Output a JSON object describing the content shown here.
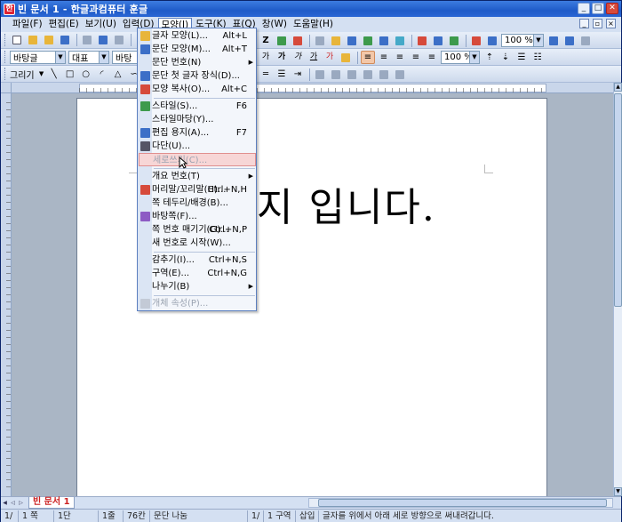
{
  "window": {
    "title": "빈 문서 1 - 한글과컴퓨터 훈글",
    "app_icon": "hwp-app-icon",
    "controls": [
      "minimize",
      "maximize",
      "close"
    ]
  },
  "menubar": {
    "items": [
      {
        "label": "파일(F)"
      },
      {
        "label": "편집(E)"
      },
      {
        "label": "보기(U)"
      },
      {
        "label": "입력(D)"
      },
      {
        "label": "모양(J)",
        "active": true
      },
      {
        "label": "도구(K)"
      },
      {
        "label": "표(Q)"
      },
      {
        "label": "창(W)"
      },
      {
        "label": "도움말(H)"
      }
    ]
  },
  "toolbar2": {
    "style_combo": "바탕글",
    "font_combo": "대표",
    "font_face_combo": "바탕",
    "zoom_combo": "100 %",
    "ratio_combo": "100 %"
  },
  "toolbar3": {
    "draw_label": "그리기"
  },
  "document": {
    "text": "지  입니다."
  },
  "format_menu": {
    "items": [
      {
        "label": "글자 모양(L)...",
        "shortcut": "Alt+L",
        "icon": "char-shape-icon"
      },
      {
        "label": "문단 모양(M)...",
        "shortcut": "Alt+T",
        "icon": "para-shape-icon"
      },
      {
        "label": "문단 번호(N)",
        "submenu": true
      },
      {
        "label": "문단 첫 글자 장식(D)...",
        "icon": "dropcap-icon"
      },
      {
        "label": "모양 복사(O)...",
        "shortcut": "Alt+C",
        "icon": "format-copy-icon"
      },
      {
        "label": "스타일(S)...",
        "shortcut": "F6",
        "icon": "style-icon"
      },
      {
        "label": "스타일마당(Y)..."
      },
      {
        "label": "편집 용지(A)...",
        "shortcut": "F7",
        "icon": "page-setup-icon"
      },
      {
        "label": "다단(U)...",
        "icon": "columns-icon"
      },
      {
        "label": "세로쓰기(C)...",
        "highlighted": true,
        "disabled": true
      },
      {
        "label": "개요 번호(T)",
        "submenu": true
      },
      {
        "label": "머리말/꼬리말(H)...",
        "shortcut": "Ctrl+N,H",
        "icon": "header-footer-icon"
      },
      {
        "label": "쪽 테두리/배경(B)..."
      },
      {
        "label": "바탕쪽(F)...",
        "icon": "master-page-icon"
      },
      {
        "label": "쪽 번호 매기기(G)...",
        "shortcut": "Ctrl+N,P"
      },
      {
        "label": "새 번호로 시작(W)..."
      },
      {
        "label": "감추기(I)...",
        "shortcut": "Ctrl+N,S"
      },
      {
        "label": "구역(E)...",
        "shortcut": "Ctrl+N,G"
      },
      {
        "label": "나누기(B)",
        "submenu": true
      },
      {
        "label": "개체 속성(P)...",
        "disabled": true,
        "icon": "object-props-icon"
      }
    ]
  },
  "tabs": [
    {
      "label": "빈 문서 1"
    }
  ],
  "statusbar": {
    "page": "1/",
    "page_num": "1 쪽",
    "col": "1단",
    "line": "1줄",
    "chars": "76칸",
    "split": "문단 나눔",
    "section_of": "1/",
    "section": "1 구역",
    "insert_mode": "삽입",
    "hint": "글자를 위에서 아래 세로 방향으로 써내려갑니다."
  },
  "colors": {
    "title_bar": "#1f5bc8",
    "menu_highlight": "#f7d6d6",
    "tab_text": "#cc2222"
  }
}
